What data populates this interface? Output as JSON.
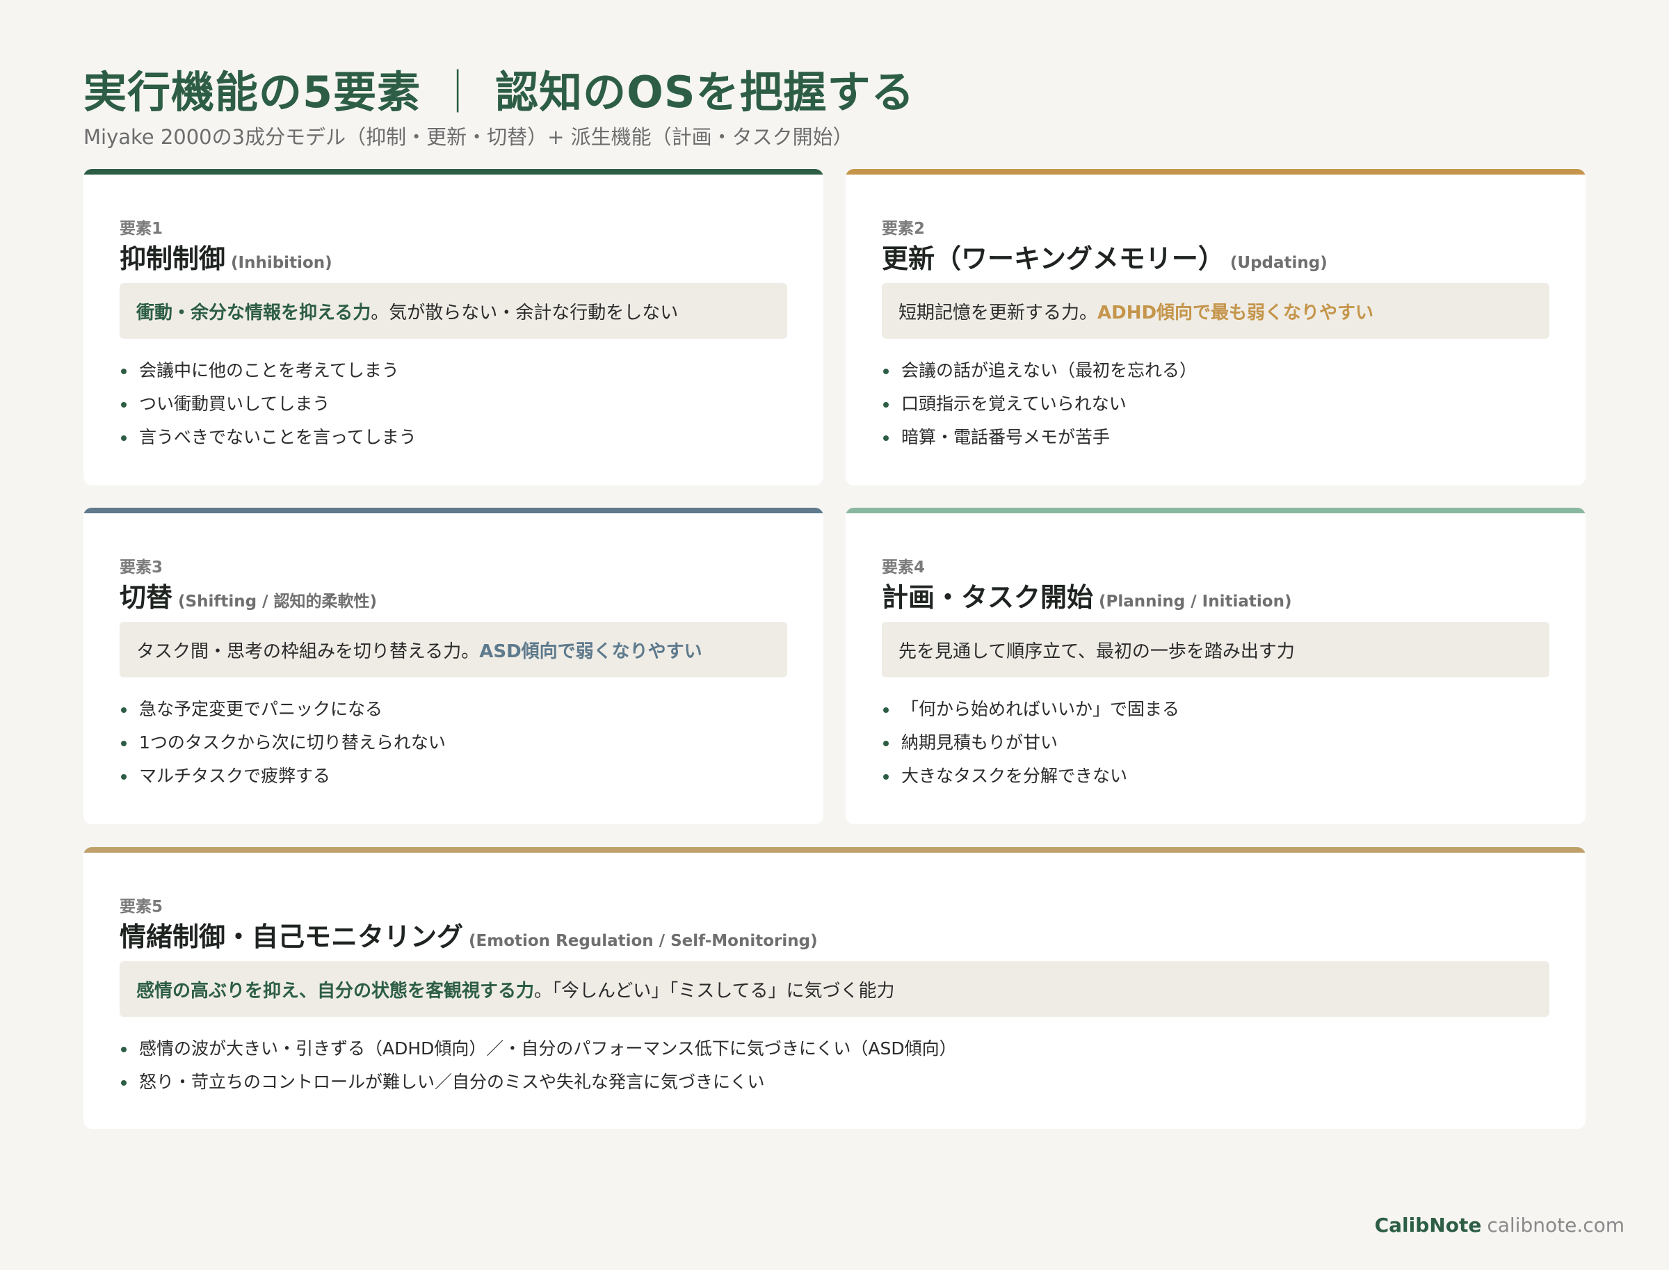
{
  "header": {
    "title_left": "実行機能の5要素",
    "title_sep": "｜",
    "title_right": "認知のOSを把握する",
    "subtitle": "Miyake 2000の3成分モデル（抑制・更新・切替）+ 派生機能（計画・タスク開始）"
  },
  "colors": {
    "green": "#2d5e45",
    "gold": "#c4954a",
    "slate": "#5e7a8c",
    "mint": "#8ab7a0",
    "tan": "#bfa06a",
    "summary_bg": "#efece6"
  },
  "cards": [
    {
      "eyebrow": "要素1",
      "title": "抑制制御",
      "en": "(Inhibition)",
      "summary_hl": "衝動・余分な情報を抑える力",
      "summary_rest": "。気が散らない・余計な行動をしない",
      "summary_pre": "",
      "bullets": [
        "会議中に他のことを考えてしまう",
        "つい衝動買いしてしまう",
        "言うべきでないことを言ってしまう"
      ]
    },
    {
      "eyebrow": "要素2",
      "title": "更新（ワーキングメモリー）",
      "en": "(Updating)",
      "summary_pre": "短期記憶を更新する力。",
      "summary_hl": "ADHD傾向で最も弱くなりやすい",
      "summary_rest": "",
      "bullets": [
        "会議の話が追えない（最初を忘れる）",
        "口頭指示を覚えていられない",
        "暗算・電話番号メモが苦手"
      ]
    },
    {
      "eyebrow": "要素3",
      "title": "切替",
      "en": "(Shifting / 認知的柔軟性)",
      "summary_pre": "タスク間・思考の枠組みを切り替える力。",
      "summary_hl": "ASD傾向で弱くなりやすい",
      "summary_rest": "",
      "bullets": [
        "急な予定変更でパニックになる",
        "1つのタスクから次に切り替えられない",
        "マルチタスクで疲弊する"
      ]
    },
    {
      "eyebrow": "要素4",
      "title": "計画・タスク開始",
      "en": "(Planning / Initiation)",
      "summary_pre": "先を見通して順序立て、最初の一歩を踏み出す力",
      "summary_hl": "",
      "summary_rest": "",
      "bullets": [
        "「何から始めればいいか」で固まる",
        "納期見積もりが甘い",
        "大きなタスクを分解できない"
      ]
    },
    {
      "eyebrow": "要素5",
      "title": "情緒制御・自己モニタリング",
      "en": "(Emotion Regulation / Self-Monitoring)",
      "summary_pre": "",
      "summary_hl": "感情の高ぶりを抑え、自分の状態を客観視する力",
      "summary_rest": "。「今しんどい」「ミスしてる」に気づく能力",
      "bullets": [
        "感情の波が大きい・引きずる（ADHD傾向）／・自分のパフォーマンス低下に気づきにくい（ASD傾向）",
        "怒り・苛立ちのコントロールが難しい／自分のミスや失礼な発言に気づきにくい"
      ]
    }
  ],
  "footer": {
    "brand": "CalibNote",
    "domain": "calibnote.com"
  }
}
